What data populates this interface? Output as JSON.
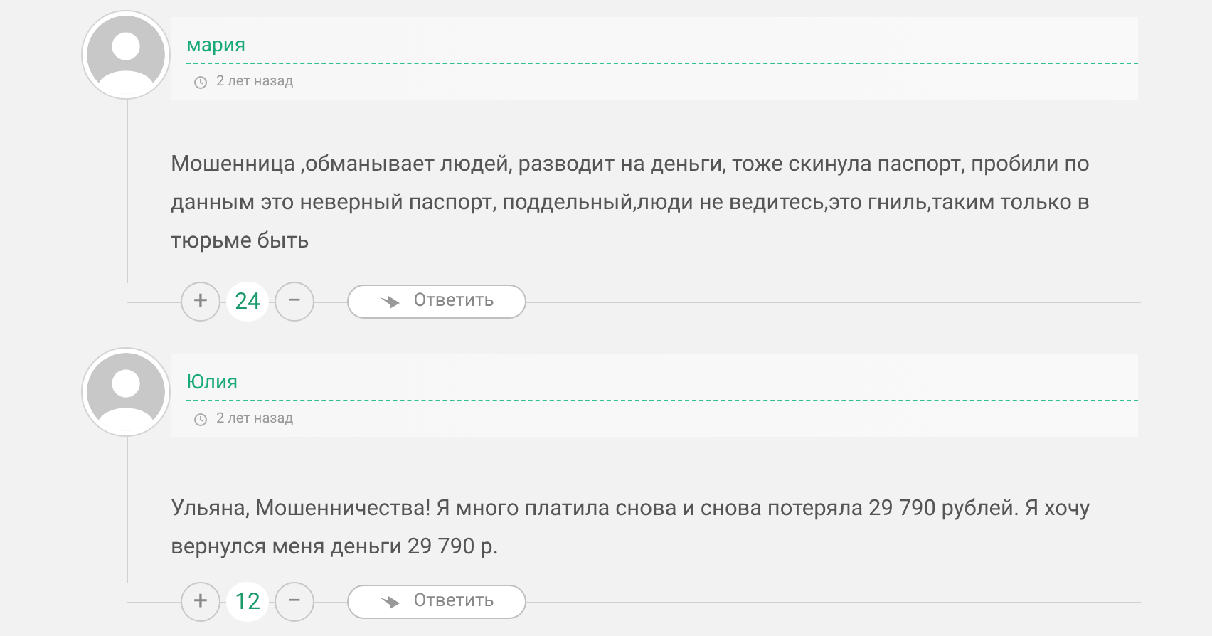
{
  "comments": [
    {
      "author": "мария",
      "time": "2 лет назад",
      "text": "Мошенница ,обманывает людей, разводит на деньги, тоже скинула паспорт, пробили по данным это неверный паспорт, поддельный,люди не ведитесь,это гниль,таким только в тюрьме быть",
      "plus": "+",
      "score": "24",
      "minus": "−",
      "reply": "Ответить"
    },
    {
      "author": "Юлия",
      "time": "2 лет назад",
      "text": "Ульяна, Мошенничества! Я много платила снова и снова потеряла 29 790 рублей. Я хочу вернулся меня деньги 29 790 р.",
      "plus": "+",
      "score": "12",
      "minus": "−",
      "reply": "Ответить"
    }
  ]
}
